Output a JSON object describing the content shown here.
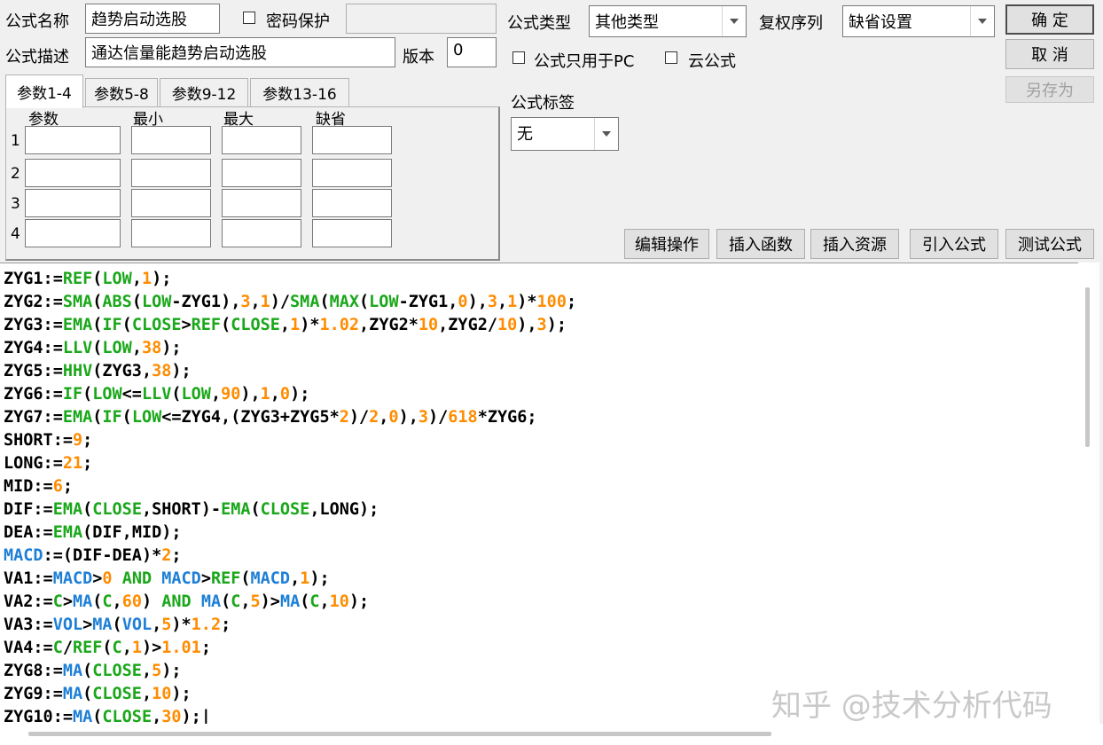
{
  "form": {
    "name_label": "公式名称",
    "name_value": "趋势启动选股",
    "password_label": "密码保护",
    "password_value": "",
    "desc_label": "公式描述",
    "desc_value": "通达信量能趋势启动选股",
    "version_label": "版本",
    "version_value": "0",
    "type_label": "公式类型",
    "type_value": "其他类型",
    "rights_label": "复权序列",
    "rights_value": "缺省设置",
    "pc_only_label": "公式只用于PC",
    "cloud_label": "云公式",
    "tag_label": "公式标签",
    "tag_value": "无"
  },
  "buttons": {
    "ok": "确 定",
    "cancel": "取 消",
    "save_as": "另存为",
    "edit_ops": "编辑操作",
    "insert_func": "插入函数",
    "insert_res": "插入资源",
    "import_formula": "引入公式",
    "test_formula": "测试公式"
  },
  "tabs": [
    "参数1-4",
    "参数5-8",
    "参数9-12",
    "参数13-16"
  ],
  "params": {
    "headers": [
      "参数",
      "最小",
      "最大",
      "缺省"
    ],
    "rows": [
      "1",
      "2",
      "3",
      "4"
    ]
  },
  "code": [
    [
      [
        "ZYG1:=",
        "p"
      ],
      [
        "REF",
        "f"
      ],
      [
        "(",
        "p"
      ],
      [
        "LOW",
        "f"
      ],
      [
        ",",
        "p"
      ],
      [
        "1",
        "n"
      ],
      [
        ");",
        "p"
      ]
    ],
    [
      [
        "ZYG2:=",
        "p"
      ],
      [
        "SMA",
        "f"
      ],
      [
        "(",
        "p"
      ],
      [
        "ABS",
        "f"
      ],
      [
        "(",
        "p"
      ],
      [
        "LOW",
        "f"
      ],
      [
        "-ZYG1),",
        "p"
      ],
      [
        "3",
        "n"
      ],
      [
        ",",
        "p"
      ],
      [
        "1",
        "n"
      ],
      [
        ")/",
        "p"
      ],
      [
        "SMA",
        "f"
      ],
      [
        "(",
        "p"
      ],
      [
        "MAX",
        "f"
      ],
      [
        "(",
        "p"
      ],
      [
        "LOW",
        "f"
      ],
      [
        "-ZYG1,",
        "p"
      ],
      [
        "0",
        "n"
      ],
      [
        "),",
        "p"
      ],
      [
        "3",
        "n"
      ],
      [
        ",",
        "p"
      ],
      [
        "1",
        "n"
      ],
      [
        ")*",
        "p"
      ],
      [
        "100",
        "n"
      ],
      [
        ";",
        "p"
      ]
    ],
    [
      [
        "ZYG3:=",
        "p"
      ],
      [
        "EMA",
        "f"
      ],
      [
        "(",
        "p"
      ],
      [
        "IF",
        "f"
      ],
      [
        "(",
        "p"
      ],
      [
        "CLOSE",
        "f"
      ],
      [
        ">",
        "p"
      ],
      [
        "REF",
        "f"
      ],
      [
        "(",
        "p"
      ],
      [
        "CLOSE",
        "f"
      ],
      [
        ",",
        "p"
      ],
      [
        "1",
        "n"
      ],
      [
        ")*",
        "p"
      ],
      [
        "1.02",
        "n"
      ],
      [
        ",ZYG2*",
        "p"
      ],
      [
        "10",
        "n"
      ],
      [
        ",ZYG2/",
        "p"
      ],
      [
        "10",
        "n"
      ],
      [
        "),",
        "p"
      ],
      [
        "3",
        "n"
      ],
      [
        ");",
        "p"
      ]
    ],
    [
      [
        "ZYG4:=",
        "p"
      ],
      [
        "LLV",
        "f"
      ],
      [
        "(",
        "p"
      ],
      [
        "LOW",
        "f"
      ],
      [
        ",",
        "p"
      ],
      [
        "38",
        "n"
      ],
      [
        ");",
        "p"
      ]
    ],
    [
      [
        "ZYG5:=",
        "p"
      ],
      [
        "HHV",
        "f"
      ],
      [
        "(ZYG3,",
        "p"
      ],
      [
        "38",
        "n"
      ],
      [
        ");",
        "p"
      ]
    ],
    [
      [
        "ZYG6:=",
        "p"
      ],
      [
        "IF",
        "f"
      ],
      [
        "(",
        "p"
      ],
      [
        "LOW",
        "f"
      ],
      [
        "<=",
        "p"
      ],
      [
        "LLV",
        "f"
      ],
      [
        "(",
        "p"
      ],
      [
        "LOW",
        "f"
      ],
      [
        ",",
        "p"
      ],
      [
        "90",
        "n"
      ],
      [
        "),",
        "p"
      ],
      [
        "1",
        "n"
      ],
      [
        ",",
        "p"
      ],
      [
        "0",
        "n"
      ],
      [
        ");",
        "p"
      ]
    ],
    [
      [
        "ZYG7:=",
        "p"
      ],
      [
        "EMA",
        "f"
      ],
      [
        "(",
        "p"
      ],
      [
        "IF",
        "f"
      ],
      [
        "(",
        "p"
      ],
      [
        "LOW",
        "f"
      ],
      [
        "<=ZYG4,(ZYG3+ZYG5*",
        "p"
      ],
      [
        "2",
        "n"
      ],
      [
        ")/",
        "p"
      ],
      [
        "2",
        "n"
      ],
      [
        ",",
        "p"
      ],
      [
        "0",
        "n"
      ],
      [
        "),",
        "p"
      ],
      [
        "3",
        "n"
      ],
      [
        ")/",
        "p"
      ],
      [
        "618",
        "n"
      ],
      [
        "*ZYG6;",
        "p"
      ]
    ],
    [
      [
        "SHORT:=",
        "p"
      ],
      [
        "9",
        "n"
      ],
      [
        ";",
        "p"
      ]
    ],
    [
      [
        "LONG:=",
        "p"
      ],
      [
        "21",
        "n"
      ],
      [
        ";",
        "p"
      ]
    ],
    [
      [
        "MID:=",
        "p"
      ],
      [
        "6",
        "n"
      ],
      [
        ";",
        "p"
      ]
    ],
    [
      [
        "DIF:=",
        "p"
      ],
      [
        "EMA",
        "f"
      ],
      [
        "(",
        "p"
      ],
      [
        "CLOSE",
        "f"
      ],
      [
        ",SHORT)-",
        "p"
      ],
      [
        "EMA",
        "f"
      ],
      [
        "(",
        "p"
      ],
      [
        "CLOSE",
        "f"
      ],
      [
        ",LONG);",
        "p"
      ]
    ],
    [
      [
        "DEA:=",
        "p"
      ],
      [
        "EMA",
        "f"
      ],
      [
        "(DIF,MID);",
        "p"
      ]
    ],
    [
      [
        "MACD",
        "v"
      ],
      [
        ":=(DIF-DEA)*",
        "p"
      ],
      [
        "2",
        "n"
      ],
      [
        ";",
        "p"
      ]
    ],
    [
      [
        "VA1:=",
        "p"
      ],
      [
        "MACD",
        "v"
      ],
      [
        ">",
        "p"
      ],
      [
        "0",
        "n"
      ],
      [
        " ",
        "p"
      ],
      [
        "AND",
        "f"
      ],
      [
        " ",
        "p"
      ],
      [
        "MACD",
        "v"
      ],
      [
        ">",
        "p"
      ],
      [
        "REF",
        "f"
      ],
      [
        "(",
        "p"
      ],
      [
        "MACD",
        "v"
      ],
      [
        ",",
        "p"
      ],
      [
        "1",
        "n"
      ],
      [
        ");",
        "p"
      ]
    ],
    [
      [
        "VA2:=",
        "p"
      ],
      [
        "C",
        "f"
      ],
      [
        ">",
        "p"
      ],
      [
        "MA",
        "v"
      ],
      [
        "(",
        "p"
      ],
      [
        "C",
        "f"
      ],
      [
        ",",
        "p"
      ],
      [
        "60",
        "n"
      ],
      [
        ") ",
        "p"
      ],
      [
        "AND",
        "f"
      ],
      [
        " ",
        "p"
      ],
      [
        "MA",
        "v"
      ],
      [
        "(",
        "p"
      ],
      [
        "C",
        "f"
      ],
      [
        ",",
        "p"
      ],
      [
        "5",
        "n"
      ],
      [
        ")>",
        "p"
      ],
      [
        "MA",
        "v"
      ],
      [
        "(",
        "p"
      ],
      [
        "C",
        "f"
      ],
      [
        ",",
        "p"
      ],
      [
        "10",
        "n"
      ],
      [
        ");",
        "p"
      ]
    ],
    [
      [
        "VA3:=",
        "p"
      ],
      [
        "VOL",
        "v"
      ],
      [
        ">",
        "p"
      ],
      [
        "MA",
        "v"
      ],
      [
        "(",
        "p"
      ],
      [
        "VOL",
        "v"
      ],
      [
        ",",
        "p"
      ],
      [
        "5",
        "n"
      ],
      [
        ")*",
        "p"
      ],
      [
        "1.2",
        "n"
      ],
      [
        ";",
        "p"
      ]
    ],
    [
      [
        "VA4:=",
        "p"
      ],
      [
        "C",
        "f"
      ],
      [
        "/",
        "p"
      ],
      [
        "REF",
        "f"
      ],
      [
        "(",
        "p"
      ],
      [
        "C",
        "f"
      ],
      [
        ",",
        "p"
      ],
      [
        "1",
        "n"
      ],
      [
        ")>",
        "p"
      ],
      [
        "1.01",
        "n"
      ],
      [
        ";",
        "p"
      ]
    ],
    [
      [
        "ZYG8:=",
        "p"
      ],
      [
        "MA",
        "v"
      ],
      [
        "(",
        "p"
      ],
      [
        "CLOSE",
        "f"
      ],
      [
        ",",
        "p"
      ],
      [
        "5",
        "n"
      ],
      [
        ");",
        "p"
      ]
    ],
    [
      [
        "ZYG9:=",
        "p"
      ],
      [
        "MA",
        "v"
      ],
      [
        "(",
        "p"
      ],
      [
        "CLOSE",
        "f"
      ],
      [
        ",",
        "p"
      ],
      [
        "10",
        "n"
      ],
      [
        ");",
        "p"
      ]
    ],
    [
      [
        "ZYG10:=",
        "p"
      ],
      [
        "MA",
        "v"
      ],
      [
        "(",
        "p"
      ],
      [
        "CLOSE",
        "f"
      ],
      [
        ",",
        "p"
      ],
      [
        "30",
        "n"
      ],
      [
        ");|",
        "p"
      ]
    ]
  ],
  "watermark": "知乎 @技术分析代码",
  "colors": {
    "function": "#1aa71a",
    "number": "#ff8c00",
    "variable": "#1e7fd6"
  }
}
